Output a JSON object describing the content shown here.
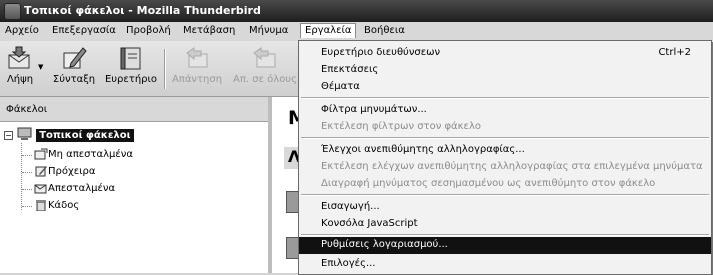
{
  "window": {
    "title": "Τοπικοί φάκελοι - Mozilla Thunderbird"
  },
  "menubar": {
    "items": [
      {
        "label": "Αρχείο"
      },
      {
        "label": "Επεξεργασία"
      },
      {
        "label": "Προβολή"
      },
      {
        "label": "Μετάβαση"
      },
      {
        "label": "Μήνυμα"
      },
      {
        "label": "Εργαλεία"
      },
      {
        "label": "Βοήθεια"
      }
    ],
    "active": "Εργαλεία"
  },
  "toolbar": {
    "buttons": [
      {
        "label": "Λήψη",
        "icon": "get-mail-icon",
        "enabled": true
      },
      {
        "label": "Σύνταξη",
        "icon": "compose-icon",
        "enabled": true
      },
      {
        "label": "Ευρετήριο",
        "icon": "address-book-icon",
        "enabled": true
      },
      {
        "label": "Απάντηση",
        "icon": "reply-icon",
        "enabled": false
      },
      {
        "label": "Απ. σε όλους",
        "icon": "reply-all-icon",
        "enabled": false
      }
    ]
  },
  "folder_pane": {
    "header": "Φάκελοι",
    "root": {
      "label": "Τοπικοί φάκελοι",
      "expanded": true
    },
    "children": [
      {
        "label": "Μη απεσταλμένα",
        "icon": "unsent-folder-icon"
      },
      {
        "label": "Πρόχειρα",
        "icon": "drafts-folder-icon"
      },
      {
        "label": "Απεσταλμένα",
        "icon": "sent-folder-icon"
      },
      {
        "label": "Κάδος",
        "icon": "trash-folder-icon"
      }
    ]
  },
  "main_pane": {
    "title_fragment": "Μ",
    "subtitle_fragment": "Λ"
  },
  "tools_menu": {
    "items": [
      {
        "label": "Ευρετήριο διευθύνσεων",
        "shortcut": "Ctrl+2",
        "enabled": true
      },
      {
        "label": "Επεκτάσεις",
        "enabled": true
      },
      {
        "label": "Θέματα",
        "enabled": true
      },
      {
        "separator": true
      },
      {
        "label": "Φίλτρα μηνυμάτων...",
        "enabled": true
      },
      {
        "label": "Εκτέλεση φίλτρων στον φάκελο",
        "enabled": false
      },
      {
        "separator": true
      },
      {
        "label": "Έλεγχοι ανεπιθύμητης αλληλογραφίας...",
        "enabled": true
      },
      {
        "label": "Εκτέλεση ελέγχων ανεπιθύμητης αλληλογραφίας στα επιλεγμένα μηνύματα",
        "enabled": false
      },
      {
        "label": "Διαγραφή μηνύματος σεσημασμένου ως ανεπιθύμητο στον φάκελο",
        "enabled": false
      },
      {
        "separator": true
      },
      {
        "label": "Εισαγωγή...",
        "enabled": true
      },
      {
        "label": "Κονσόλα JavaScript",
        "enabled": true
      },
      {
        "separator": true
      },
      {
        "label": "Ρυθμίσεις λογαριασμού...",
        "enabled": true,
        "highlighted": true
      },
      {
        "label": "Επιλογές...",
        "enabled": true
      }
    ]
  }
}
